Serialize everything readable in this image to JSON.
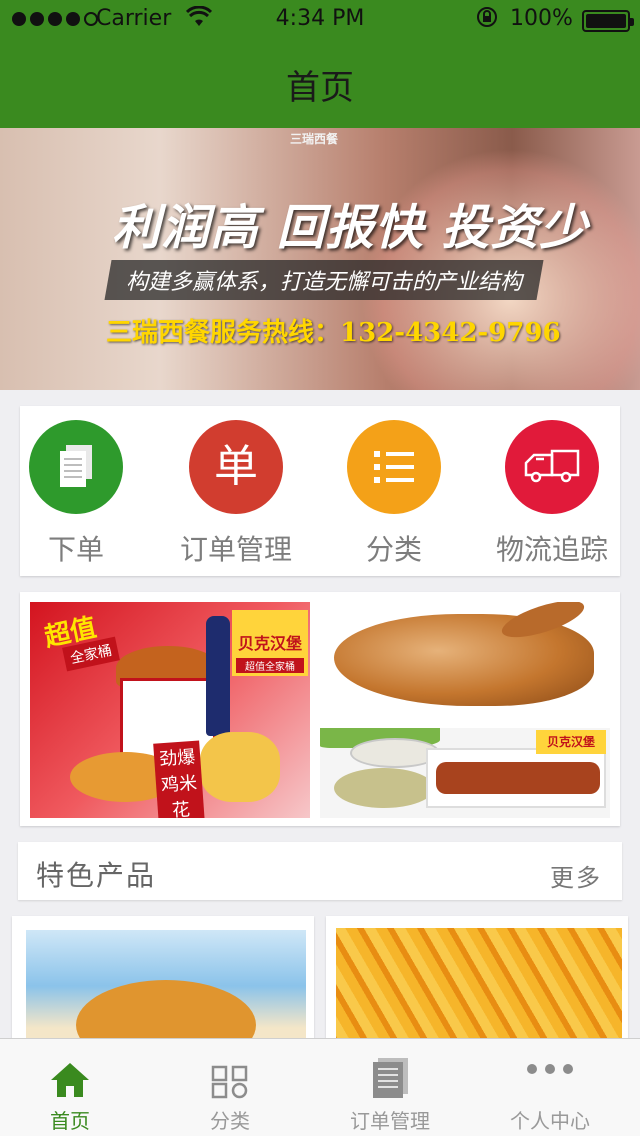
{
  "status_bar": {
    "carrier": "Carrier",
    "time": "4:34 PM",
    "battery": "100%"
  },
  "nav": {
    "title": "首页"
  },
  "banner": {
    "brand": "三瑞西餐",
    "headline": "利润高 回报快 投资少",
    "tagline": "构建多赢体系，打造无懈可击的产业结构",
    "hotline": "三瑞西餐服务热线：132-4342-9796"
  },
  "actions": [
    {
      "label": "下单",
      "color": "#2e9a2c",
      "icon": "document-icon"
    },
    {
      "label": "订单管理",
      "color": "#d13d2f",
      "icon": "order-icon",
      "glyph": "单"
    },
    {
      "label": "分类",
      "color": "#f4a118",
      "icon": "list-icon"
    },
    {
      "label": "物流追踪",
      "color": "#e11a3a",
      "icon": "truck-icon"
    }
  ],
  "promo": {
    "left": {
      "tag_value": "超值",
      "tag_family": "全家桶",
      "logo": "贝克汉堡",
      "logo_sub": "超值全家桶",
      "fried_label": "劲爆鸡米花"
    },
    "right_bottom_logo": "贝克汉堡"
  },
  "featured": {
    "title": "特色产品",
    "more": "更多"
  },
  "tabbar": {
    "items": [
      {
        "label": "首页",
        "icon": "home-icon",
        "active": true
      },
      {
        "label": "分类",
        "icon": "grid-icon",
        "active": false
      },
      {
        "label": "订单管理",
        "icon": "document-icon",
        "active": false
      },
      {
        "label": "个人中心",
        "icon": "more-icon",
        "active": false
      }
    ],
    "active_color": "#3a8a1f",
    "inactive_color": "#999999"
  },
  "colors": {
    "header_green": "#3a8a1f",
    "background": "#efeff2"
  }
}
